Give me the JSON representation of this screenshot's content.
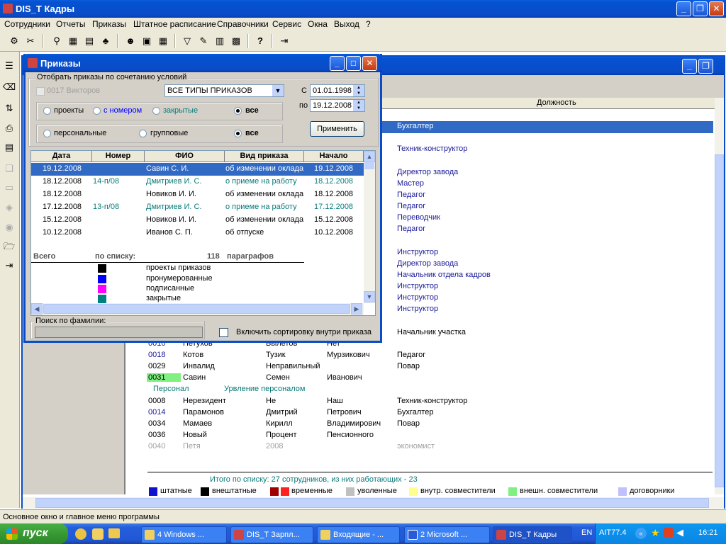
{
  "main_window": {
    "title": "DIS_Т Кадры"
  },
  "menu": [
    "Сотрудники",
    "Отчеты",
    "Приказы",
    "Штатное расписание",
    "Справочники",
    "Сервис",
    "Окна",
    "Выход",
    "?"
  ],
  "employee_grid": {
    "column_header": "Должность",
    "top_positions": [
      {
        "text": "Бухгалтер",
        "selected": true
      },
      {
        "text": "Техник-конструктор"
      },
      {
        "text": "Директор завода"
      },
      {
        "text": "Мастер"
      },
      {
        "text": "Педагог"
      },
      {
        "text": "Педагог"
      },
      {
        "text": "Переводчик"
      },
      {
        "text": "Педагог"
      },
      {
        "text": "Инструктор"
      },
      {
        "text": "Директор завода"
      },
      {
        "text": "Начальник отдела кадров"
      },
      {
        "text": "Инструктор"
      },
      {
        "text": "Инструктор"
      },
      {
        "text": "Инструктор"
      },
      {
        "text": "Начальник участка"
      }
    ],
    "rows": [
      {
        "id": "0010",
        "last": "Петухов",
        "first": "Вылетов",
        "middle": "Нет",
        "position": ""
      },
      {
        "id": "0018",
        "last": "Котов",
        "first": "Тузик",
        "middle": "Мурзикович",
        "position": "Педагог"
      },
      {
        "id": "0029",
        "last": "Инвалид",
        "first": "Неправильный",
        "middle": "",
        "position": "Повар"
      },
      {
        "id": "0031",
        "last": "Савин",
        "first": "Семен",
        "middle": "Иванович",
        "position": ""
      }
    ],
    "group": {
      "dept": "Персонал",
      "name": "Урвление персоналом"
    },
    "rows2": [
      {
        "id": "0008",
        "last": "Нерезидент",
        "first": "Не",
        "middle": "Наш",
        "position": "Техник-конструктор"
      },
      {
        "id": "0014",
        "last": "Парамонов",
        "first": "Дмитрий",
        "middle": "Петрович",
        "position": "Бухгалтер"
      },
      {
        "id": "0034",
        "last": "Мамаев",
        "first": "Кирилл",
        "middle": "Владимирович",
        "position": "Повар"
      },
      {
        "id": "0036",
        "last": "Новый",
        "first": "Процент",
        "middle": "Пенсионного",
        "position": ""
      },
      {
        "id": "0040",
        "last": "Петя",
        "first": "2008",
        "middle": "",
        "position": "экономист"
      }
    ],
    "total": "Итого по списку: 27 сотрудников, из них работающих - 23",
    "legend": [
      {
        "label": "штатные",
        "color": "#1010d0"
      },
      {
        "label": "внештатные",
        "color": "#000000"
      },
      {
        "label": "временные",
        "color": "#a00000",
        "color2": "#ff2020"
      },
      {
        "label": "уволенные",
        "color": "#c0c0c0"
      },
      {
        "label": "внутр. совместители",
        "color": "#ffff90"
      },
      {
        "label": "внешн. совместители",
        "color": "#80f080"
      },
      {
        "label": "договорники",
        "color": "#c0c0ff"
      }
    ]
  },
  "orders_dialog": {
    "title": "Приказы",
    "filter_group": "Отобрать приказы по сочетанию условий",
    "employee_checkbox": "0017 Викторов",
    "order_type": "ВСЕ ТИПЫ ПРИКАЗОВ",
    "date_from_label": "С",
    "date_from": "01.01.1998",
    "date_to_label": "по",
    "date_to": "19.12.2008",
    "status_options": [
      "проекты",
      "с номером",
      "закрытые",
      "все"
    ],
    "scope_options": [
      "персональные",
      "групповые",
      "все"
    ],
    "apply_button": "Применить",
    "columns": [
      "Дата",
      "Номер",
      "ФИО",
      "Вид приказа",
      "Начало"
    ],
    "rows": [
      {
        "date": "19.12.2008",
        "number": "",
        "fio": "Савин С. И.",
        "type": "об изменении оклада",
        "start": "19.12.2008",
        "color": "black",
        "selected": true
      },
      {
        "date": "18.12.2008",
        "number": "14-п/08",
        "fio": "Дмитриев И. С.",
        "type": "о приеме на работу",
        "start": "18.12.2008",
        "color": "teal"
      },
      {
        "date": "18.12.2008",
        "number": "",
        "fio": "Новиков И. И.",
        "type": "об изменении оклада",
        "start": "18.12.2008",
        "color": "black"
      },
      {
        "date": "17.12.2008",
        "number": "13-п/08",
        "fio": "Дмитриев И. С.",
        "type": "о приеме на работу",
        "start": "17.12.2008",
        "color": "teal"
      },
      {
        "date": "15.12.2008",
        "number": "",
        "fio": "Новиков И. И.",
        "type": "об изменении оклада",
        "start": "15.12.2008",
        "color": "black"
      },
      {
        "date": "10.12.2008",
        "number": "",
        "fio": "Иванов С. П.",
        "type": "об отпуске",
        "start": "10.12.2008",
        "color": "black"
      }
    ],
    "summary": {
      "total_label": "Всего",
      "by_list_label": "по списку:",
      "count": "118",
      "unit": "параграфов"
    },
    "legend": [
      {
        "label": "проекты приказов",
        "color": "#000000"
      },
      {
        "label": "пронумерованные",
        "color": "#0000ff"
      },
      {
        "label": "подписанные",
        "color": "#ff00ff"
      },
      {
        "label": "закрытые",
        "color": "#008080"
      }
    ],
    "search_label": "Поиск по фамилии:",
    "sort_checkbox": "Включить сортировку внутри приказа"
  },
  "status_bar": "Основное окно и главное меню программы",
  "taskbar": {
    "start": "пуск",
    "tasks": [
      "4 Windows ...",
      "DIS_Т Зарпл...",
      "Входящие - ...",
      "2 Microsoft ...",
      "DIS_Т Кадры"
    ],
    "lang": "EN",
    "tray_text": "AIT77.4",
    "clock": "16:21"
  }
}
